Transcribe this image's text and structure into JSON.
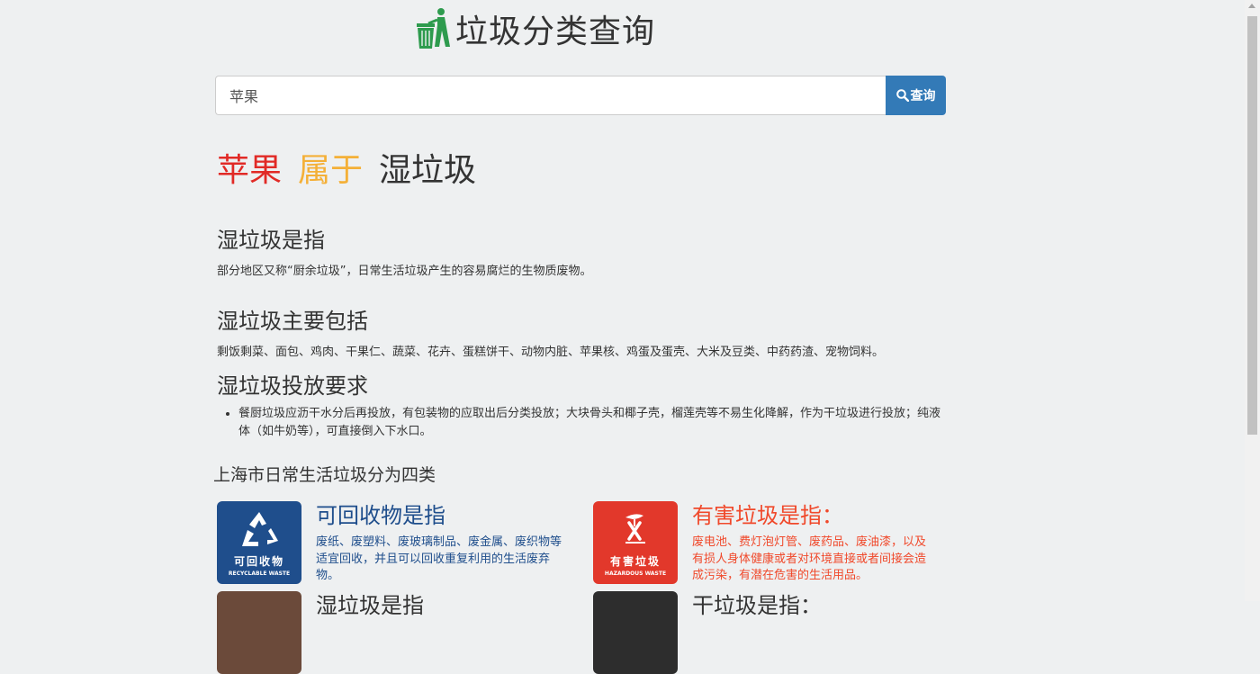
{
  "header": {
    "title": "垃圾分类查询",
    "logo_icon": "trash-bin-person-icon"
  },
  "search": {
    "value": "苹果",
    "button_label": "查询",
    "button_icon": "search-icon"
  },
  "result": {
    "item": "苹果",
    "belongs": "属于",
    "category": "湿垃圾"
  },
  "definition": {
    "heading": "湿垃圾是指",
    "text": "部分地区又称“厨余垃圾”，日常生活垃圾产生的容易腐烂的生物质废物。"
  },
  "includes": {
    "heading": "湿垃圾主要包括",
    "text": "剩饭剩菜、面包、鸡肉、干果仁、蔬菜、花卉、蛋糕饼干、动物内脏、苹果核、鸡蛋及蛋壳、大米及豆类、中药药渣、宠物饲料。"
  },
  "requirements": {
    "heading": "湿垃圾投放要求",
    "items": [
      "餐厨垃圾应沥干水分后再投放，有包装物的应取出后分类投放；大块骨头和椰子壳，榴莲壳等不易生化降解，作为干垃圾进行投放；纯液体（如牛奶等），可直接倒入下水口。"
    ]
  },
  "shanghai": {
    "title": "上海市日常生活垃圾分为四类",
    "cards": [
      {
        "img_cn": "可回收物",
        "img_en": "RECYCLABLE WASTE",
        "title": "可回收物是指",
        "desc": "废纸、废塑料、废玻璃制品、废金属、废织物等适宜回收，并且可以回收重复利用的生活废弃物。",
        "color": "#1f4e8c",
        "text_color": "#1f4e8c"
      },
      {
        "img_cn": "有害垃圾",
        "img_en": "HAZARDOUS WASTE",
        "title": "有害垃圾是指：",
        "desc": "废电池、费灯泡灯管、废药品、废油漆，以及有损人身体健康或者对环境直接或者间接会造成污染，有潜在危害的生活用品。",
        "color": "#e2382b",
        "text_color": "#f0492b"
      },
      {
        "title": "湿垃圾是指",
        "color": "#6b4a3a",
        "text_color": "#333333"
      },
      {
        "title": "干垃圾是指：",
        "color": "#2d2d2d",
        "text_color": "#333333"
      }
    ]
  },
  "colors": {
    "accent": "#337ab7",
    "item": "#e12a26",
    "belongs": "#f4b038"
  }
}
